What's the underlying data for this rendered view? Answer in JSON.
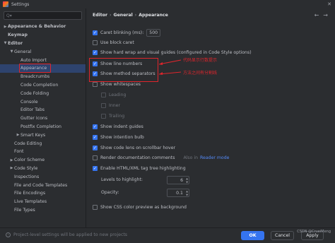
{
  "window": {
    "title": "Settings"
  },
  "sidebar": {
    "search_placeholder": "Q▾",
    "items": [
      {
        "label": "Appearance & Behavior",
        "arrow": "▶",
        "level": 0,
        "bold": true
      },
      {
        "label": "Keymap",
        "arrow": "",
        "level": 0,
        "bold": true
      },
      {
        "label": "Editor",
        "arrow": "▼",
        "level": 0,
        "bold": true
      },
      {
        "label": "General",
        "arrow": "▼",
        "level": 1
      },
      {
        "label": "Auto Import",
        "arrow": "",
        "level": 2
      },
      {
        "label": "Appearance",
        "arrow": "",
        "level": 2,
        "selected": true
      },
      {
        "label": "Breadcrumbs",
        "arrow": "",
        "level": 2
      },
      {
        "label": "Code Completion",
        "arrow": "",
        "level": 2
      },
      {
        "label": "Code Folding",
        "arrow": "",
        "level": 2
      },
      {
        "label": "Console",
        "arrow": "",
        "level": 2
      },
      {
        "label": "Editor Tabs",
        "arrow": "",
        "level": 2
      },
      {
        "label": "Gutter Icons",
        "arrow": "",
        "level": 2
      },
      {
        "label": "Postfix Completion",
        "arrow": "",
        "level": 2
      },
      {
        "label": "Smart Keys",
        "arrow": "▶",
        "level": 2
      },
      {
        "label": "Code Editing",
        "arrow": "",
        "level": 1
      },
      {
        "label": "Font",
        "arrow": "",
        "level": 1
      },
      {
        "label": "Color Scheme",
        "arrow": "▶",
        "level": 1
      },
      {
        "label": "Code Style",
        "arrow": "▶",
        "level": 1
      },
      {
        "label": "Inspections",
        "arrow": "",
        "level": 1
      },
      {
        "label": "File and Code Templates",
        "arrow": "",
        "level": 1
      },
      {
        "label": "File Encodings",
        "arrow": "",
        "level": 1
      },
      {
        "label": "Live Templates",
        "arrow": "",
        "level": 1
      },
      {
        "label": "File Types",
        "arrow": "",
        "level": 1
      }
    ]
  },
  "breadcrumb": {
    "editor": "Editor",
    "sep": "›",
    "general": "General",
    "appearance": "Appearance"
  },
  "options": {
    "caret_blinking": "Caret blinking (ms):",
    "caret_blinking_value": "500",
    "block_caret": "Use block caret",
    "hard_wrap": "Show hard wrap and visual guides (configured in Code Style options)",
    "line_numbers": "Show line numbers",
    "method_separators": "Show method separators",
    "whitespaces": "Show whitespaces",
    "leading": "Leading",
    "inner": "Inner",
    "trailing": "Trailing",
    "indent_guides": "Show indent guides",
    "intention_bulb": "Show intention bulb",
    "code_lens": "Show code lens on scrollbar hover",
    "render_docs": "Render documentation comments",
    "render_docs_also": "Also in",
    "render_docs_link": "Reader mode",
    "html_highlight": "Enable HTML/XML tag tree highlighting",
    "levels_label": "Levels to highlight:",
    "levels_value": "6",
    "opacity_label": "Opacity:",
    "opacity_value": "0.1",
    "css_preview": "Show CSS color preview as background"
  },
  "annotations": {
    "line_numbers_note": "代码显示行数提示",
    "separators_note": "方法之间有分割线"
  },
  "footer": {
    "note": "Project-level settings will be applied to new projects",
    "ok": "OK",
    "cancel": "Cancel",
    "apply": "Apply",
    "watermark": "CSDN @CrueiMeng"
  },
  "colors": {
    "accent": "#3574f0",
    "selection": "#2e436e",
    "annotation": "#e0252c"
  }
}
